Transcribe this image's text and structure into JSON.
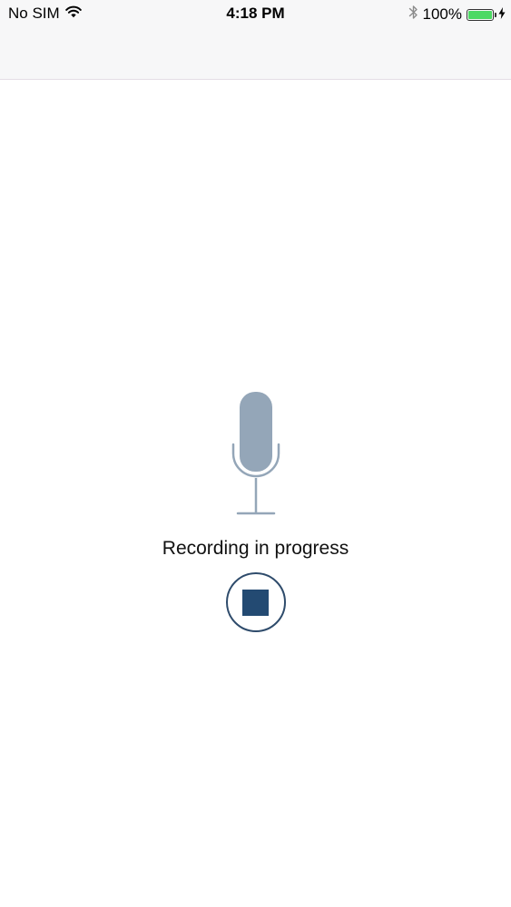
{
  "status_bar": {
    "carrier": "No SIM",
    "time": "4:18 PM",
    "battery_percent": "100%",
    "battery_level": 1.0,
    "icons": [
      "wifi-icon",
      "bluetooth-icon",
      "battery-icon",
      "charging-bolt-icon"
    ]
  },
  "recorder": {
    "status_text": "Recording in progress",
    "mic_icon": "microphone-icon",
    "stop_icon": "stop-icon"
  },
  "colors": {
    "mic": "#94a6b8",
    "stop_accent": "#234a72",
    "battery_fill": "#4cd964",
    "topbar_bg": "#f7f7f8"
  }
}
